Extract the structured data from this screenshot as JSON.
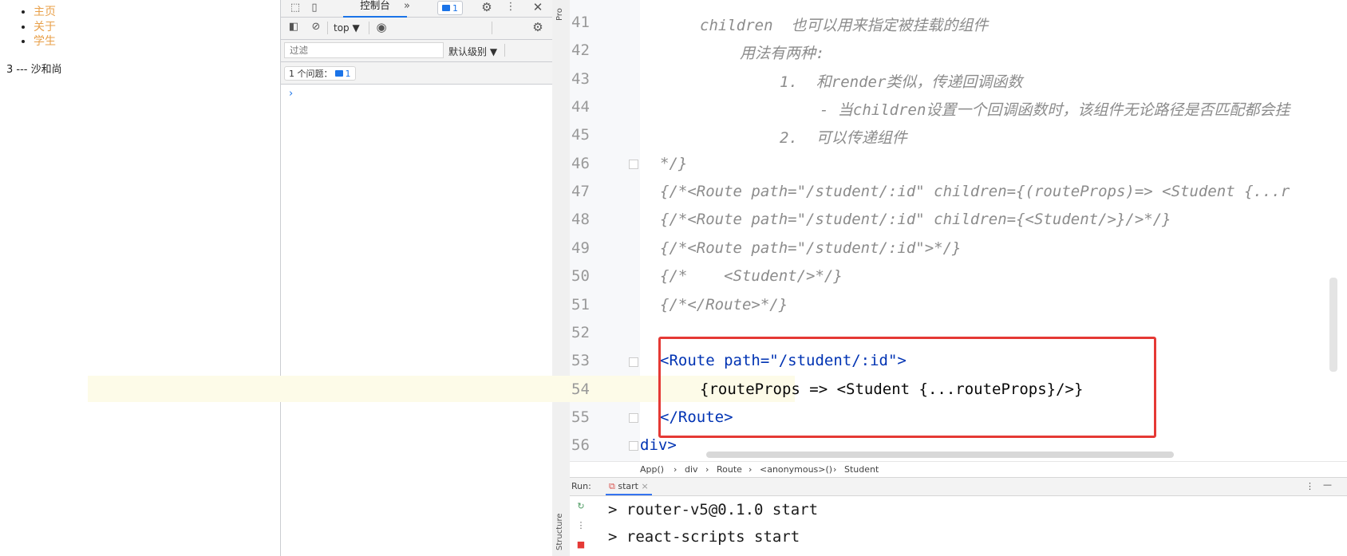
{
  "webpage": {
    "nav_links": [
      "主页",
      "关于",
      "学生"
    ],
    "output": "3 --- 沙和尚"
  },
  "devtools": {
    "tab_console": "控制台",
    "more_tabs": "»",
    "issues_badge_count": "1",
    "context_select": "top ▼",
    "filter_placeholder": "过滤",
    "level_select": "默认级别 ▼",
    "issues_label": "1 个问题：",
    "issues_count": "1",
    "prompt": "›"
  },
  "ide": {
    "side_labels": {
      "project": "Pro",
      "structure": "Structure"
    },
    "code_lines": [
      {
        "num": "41",
        "text": "children  也可以用来指定被挂载的组件"
      },
      {
        "num": "42",
        "text": "用法有两种:"
      },
      {
        "num": "43",
        "text": "1.  和render类似，传递回调函数"
      },
      {
        "num": "44",
        "text": "- 当children设置一个回调函数时，该组件无论路径是否匹配都会挂"
      },
      {
        "num": "45",
        "text": "2.  可以传递组件"
      },
      {
        "num": "46",
        "text": "*/}"
      },
      {
        "num": "47",
        "text": "{/*<Route path=\"/student/:id\" children={(routeProps)=> <Student {...r"
      },
      {
        "num": "48",
        "text": "{/*<Route path=\"/student/:id\" children={<Student/>}/>*/}"
      },
      {
        "num": "49",
        "text": "{/*<Route path=\"/student/:id\">*/}"
      },
      {
        "num": "50",
        "text": "{/*    <Student/>*/}"
      },
      {
        "num": "51",
        "text": "{/*</Route>*/}"
      },
      {
        "num": "52",
        "text": ""
      },
      {
        "num": "53",
        "text": "<Route path=\"/student/:id\">"
      },
      {
        "num": "54",
        "text": "{routeProps => <Student {...routeProps}/>}"
      },
      {
        "num": "55",
        "text": "</Route>"
      },
      {
        "num": "56",
        "text": "div>"
      }
    ],
    "breadcrumb": [
      "App()",
      "div",
      "Route",
      "<anonymous>()",
      "Student"
    ],
    "run_label": "Run:",
    "run_tab": "start",
    "console_lines": [
      "> router-v5@0.1.0 start",
      "> react-scripts start"
    ],
    "highlight_color": "#e53935"
  }
}
